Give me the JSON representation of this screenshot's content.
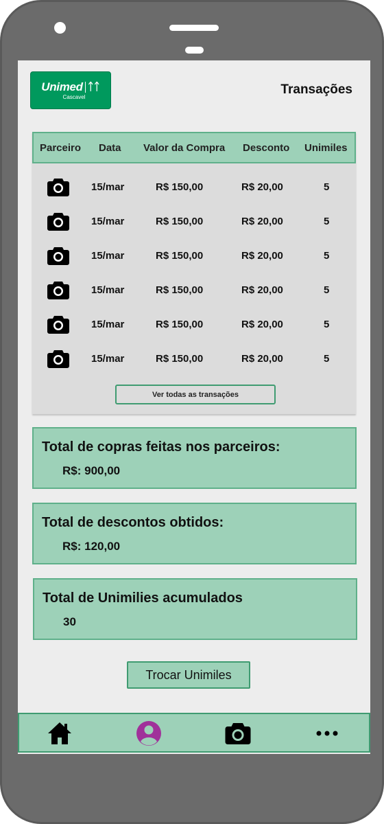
{
  "header": {
    "logo_text": "Unimed",
    "logo_subtext": "Cascavel",
    "page_title": "Transações"
  },
  "table": {
    "columns": [
      "Parceiro",
      "Data",
      "Valor da Compra",
      "Desconto",
      "Unimiles"
    ],
    "rows": [
      {
        "partner_icon": "camera-icon",
        "date": "15/mar",
        "value": "R$ 150,00",
        "discount": "R$ 20,00",
        "unimiles": "5"
      },
      {
        "partner_icon": "camera-icon",
        "date": "15/mar",
        "value": "R$ 150,00",
        "discount": "R$ 20,00",
        "unimiles": "5"
      },
      {
        "partner_icon": "camera-icon",
        "date": "15/mar",
        "value": "R$ 150,00",
        "discount": "R$ 20,00",
        "unimiles": "5"
      },
      {
        "partner_icon": "camera-icon",
        "date": "15/mar",
        "value": "R$ 150,00",
        "discount": "R$ 20,00",
        "unimiles": "5"
      },
      {
        "partner_icon": "camera-icon",
        "date": "15/mar",
        "value": "R$ 150,00",
        "discount": "R$ 20,00",
        "unimiles": "5"
      },
      {
        "partner_icon": "camera-icon",
        "date": "15/mar",
        "value": "R$ 150,00",
        "discount": "R$ 20,00",
        "unimiles": "5"
      }
    ],
    "see_all_label": "Ver todas as transações"
  },
  "summaries": [
    {
      "label": "Total de copras feitas nos parceiros:",
      "value": "R$: 900,00"
    },
    {
      "label": "Total de descontos obtidos:",
      "value": "R$: 120,00"
    },
    {
      "label": "Total de Unimilies acumulados",
      "value": "30"
    }
  ],
  "actions": {
    "trade_label": "Trocar Unimiles"
  },
  "bottom_nav": {
    "items": [
      {
        "icon": "home-icon"
      },
      {
        "icon": "profile-icon"
      },
      {
        "icon": "camera-icon"
      },
      {
        "icon": "more-icon"
      }
    ]
  },
  "colors": {
    "brand": "#00995d",
    "accent_bg": "#9dd1b8",
    "accent_border": "#3f9b71",
    "profile_icon": "#a0319a"
  }
}
